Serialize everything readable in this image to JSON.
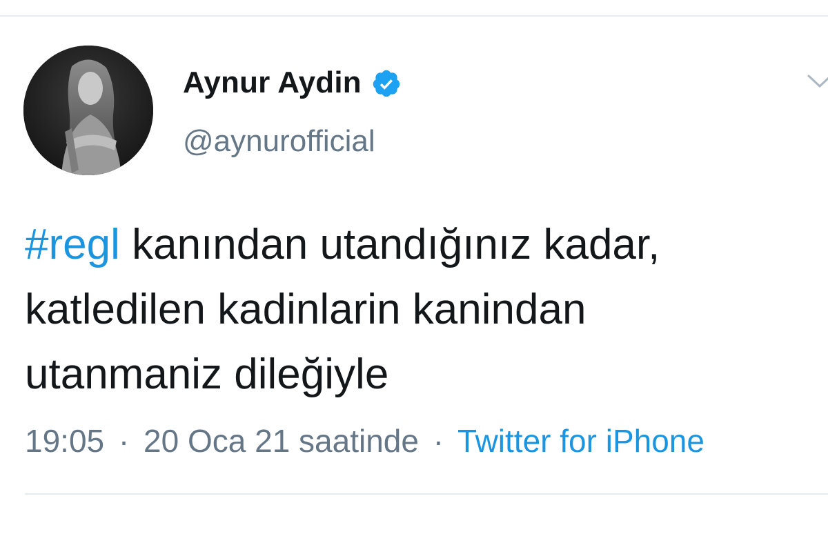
{
  "tweet": {
    "author": {
      "display_name": "Aynur Aydin",
      "handle": "@aynurofficial",
      "verified": true,
      "avatar_icon": "profile-photo"
    },
    "menu_icon": "chevron-down-icon",
    "text": {
      "hashtag": "#regl",
      "line1_rest": " kanından utandığınız kadar,",
      "line2": "katledilen kadinlarin kanindan",
      "line3": "utanmaniz dileğiyle"
    },
    "meta": {
      "time": "19:05",
      "separator": "·",
      "date": "20 Oca 21 saatinde",
      "source": "Twitter for iPhone"
    }
  },
  "colors": {
    "link": "#1b95e0",
    "verified_badge": "#1da1f2",
    "secondary_text": "#657786",
    "primary_text": "#14171a",
    "divider": "#e6ecf0"
  }
}
